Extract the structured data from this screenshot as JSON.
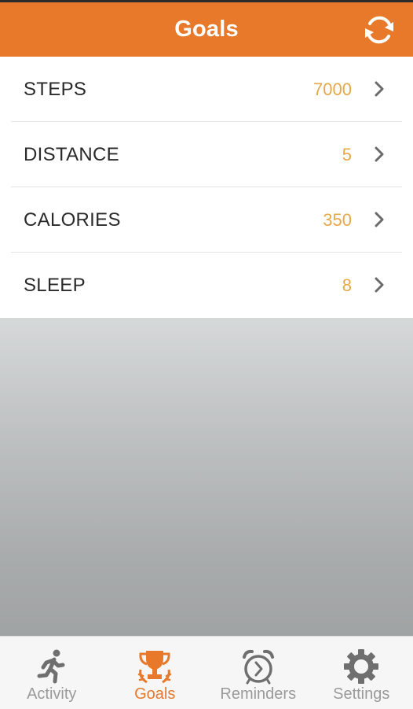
{
  "header": {
    "title": "Goals",
    "sync_icon": "sync-icon",
    "color": "#e8792a"
  },
  "goals": [
    {
      "label": "STEPS",
      "value": "7000"
    },
    {
      "label": "DISTANCE",
      "value": "5"
    },
    {
      "label": "CALORIES",
      "value": "350"
    },
    {
      "label": "SLEEP",
      "value": "8"
    }
  ],
  "tabs": [
    {
      "label": "Activity",
      "icon": "running-person-icon",
      "active": false
    },
    {
      "label": "Goals",
      "icon": "trophy-icon",
      "active": true
    },
    {
      "label": "Reminders",
      "icon": "alarm-clock-icon",
      "active": false
    },
    {
      "label": "Settings",
      "icon": "gear-icon",
      "active": false
    }
  ],
  "colors": {
    "accent": "#e8792a",
    "value": "#e7a84a",
    "inactive_tab": "#9a9a9a"
  }
}
